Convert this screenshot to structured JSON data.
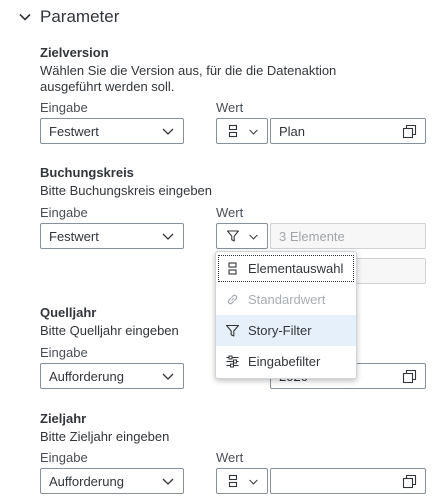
{
  "section": {
    "title": "Parameter"
  },
  "labels": {
    "eingabe": "Eingabe",
    "wert": "Wert"
  },
  "params": {
    "zielversion": {
      "title": "Zielversion",
      "description_line1": "Wählen Sie die Version aus, für die die Datenaktion",
      "description_line2": "ausgeführt werden soll.",
      "eingabe": "Festwert",
      "value": "Plan"
    },
    "buchungskreis": {
      "title": "Buchungskreis",
      "description": "Bitte Buchungskreis eingeben",
      "eingabe": "Festwert",
      "value": "3 Elemente"
    },
    "quelljahr": {
      "title": "Quelljahr",
      "description": "Bitte Quelljahr eingeben",
      "eingabe": "Aufforderung",
      "value": "2020"
    },
    "zieljahr": {
      "title": "Zieljahr",
      "description": "Bitte Zieljahr eingeben",
      "eingabe": "Aufforderung",
      "value": ""
    }
  },
  "menu": {
    "items": [
      {
        "label": "Elementauswahl",
        "icon": "member-selection-icon",
        "state": "focused"
      },
      {
        "label": "Standardwert",
        "icon": "link-icon",
        "state": "disabled"
      },
      {
        "label": "Story-Filter",
        "icon": "filter-icon",
        "state": "hovered"
      },
      {
        "label": "Eingabefilter",
        "icon": "input-filter-icon",
        "state": "normal"
      }
    ]
  },
  "colors": {
    "text": "#32363a",
    "border": "#89919a",
    "hover": "#e5f0fa",
    "disabled": "#a9aeb3"
  }
}
